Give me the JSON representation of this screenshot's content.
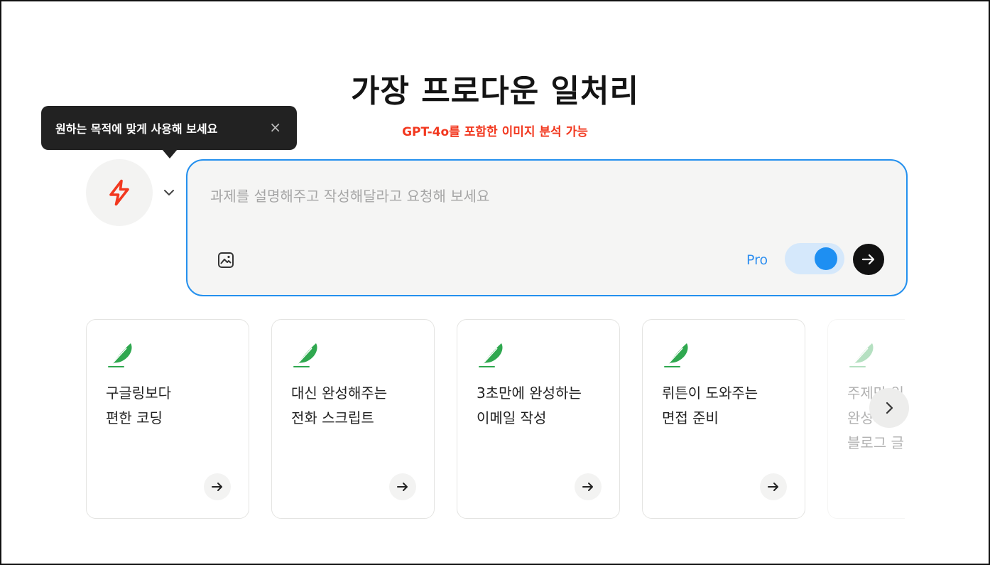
{
  "header": {
    "title": "가장 프로다운 일처리",
    "subtitle": "GPT-4o를 포함한 이미지 분석 가능"
  },
  "tooltip": {
    "text": "원하는 목적에 맞게 사용해 보세요",
    "close_icon": "×"
  },
  "mode_selector": {
    "icon": "lightning-icon",
    "accent": "#f2381f"
  },
  "composer": {
    "placeholder": "과제를 설명해주고 작성해달라고 요청해 보세요",
    "pro_label": "Pro",
    "pro_enabled": true,
    "accent": "#2490ee"
  },
  "cards": [
    {
      "line1": "구글링보다",
      "line2": "편한 코딩",
      "line3": ""
    },
    {
      "line1": "대신 완성해주는",
      "line2": "전화 스크립트",
      "line3": ""
    },
    {
      "line1": "3초만에 완성하는",
      "line2": "이메일 작성",
      "line3": ""
    },
    {
      "line1": "뤼튼이 도와주는",
      "line2": "면접 준비",
      "line3": ""
    },
    {
      "line1": "주제만 입력하면",
      "line2": "완성되는",
      "line3": "블로그 글"
    }
  ],
  "colors": {
    "feather": "#2fa84f"
  }
}
